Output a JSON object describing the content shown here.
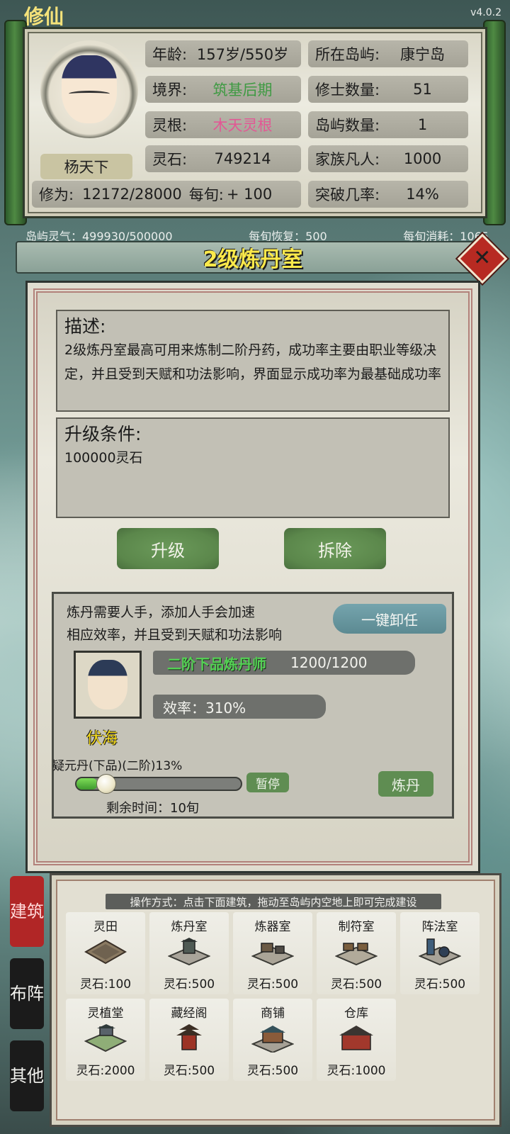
{
  "app": {
    "version": "v4.0.2",
    "corner_title": "修仙"
  },
  "player": {
    "name": "杨天下",
    "age_label": "年龄:",
    "age_value": "157岁/550岁",
    "realm_label": "境界:",
    "realm_value": "筑基后期",
    "root_label": "灵根:",
    "root_value": "木天灵根",
    "stone_label": "灵石:",
    "stone_value": "749214",
    "cultivation_label": "修为:",
    "cultivation_value": "12172/28000",
    "per_turn_label": "每旬:",
    "per_turn_value": "+ 100",
    "island_label": "所在岛屿:",
    "island_value": "康宁岛",
    "cultivators_label": "修士数量:",
    "cultivators_value": "51",
    "islands_label": "岛屿数量:",
    "islands_value": "1",
    "mortals_label": "家族凡人:",
    "mortals_value": "1000",
    "breakthrough_label": "突破几率:",
    "breakthrough_value": "14%"
  },
  "island_status": {
    "qi": "岛屿灵气：499930/500000",
    "recover": "每旬恢复：500",
    "consume": "每旬消耗：1065"
  },
  "dialog": {
    "title": "2级炼丹室",
    "close_icon": "close-icon",
    "desc_title": "描述:",
    "desc_text": "2级炼丹室最高可用来炼制二阶丹药，成功率主要由职业等级决定，并且受到天赋和功法影响，界面显示成功率为最基础成功率",
    "upgrade_title": "升级条件:",
    "upgrade_text": "100000灵石",
    "upgrade_button": "升级",
    "demolish_button": "拆除",
    "worker_note_1": "炼丹需要人手，添加人手会加速",
    "worker_note_2": "相应效率，并且受到天赋和功法影响",
    "dismiss_button": "一键卸任",
    "worker_name": "伏海",
    "worker_rank": "二阶下品炼丹师",
    "worker_exp": "1200/1200",
    "efficiency": "效率：310%",
    "brewing_item": "疑元丹(下品)(二阶)13%",
    "brewing_progress": 0.13,
    "pause_button": "暂停",
    "brew_button": "炼丹",
    "remaining_time": "剩余时间：10旬"
  },
  "side_tabs": [
    {
      "label": "建筑",
      "active": true
    },
    {
      "label": "布阵",
      "active": false
    },
    {
      "label": "其他",
      "active": false
    }
  ],
  "build_panel": {
    "hint": "操作方式：点击下面建筑，拖动至岛屿内空地上即可完成建设",
    "buildings": [
      {
        "name": "灵田",
        "cost": "灵石:100",
        "icon": "field-icon"
      },
      {
        "name": "炼丹室",
        "cost": "灵石:500",
        "icon": "alchemy-room-icon"
      },
      {
        "name": "炼器室",
        "cost": "灵石:500",
        "icon": "forge-room-icon"
      },
      {
        "name": "制符室",
        "cost": "灵石:500",
        "icon": "talisman-room-icon"
      },
      {
        "name": "阵法室",
        "cost": "灵石:500",
        "icon": "formation-room-icon"
      },
      {
        "name": "灵植堂",
        "cost": "灵石:2000",
        "icon": "herb-hall-icon"
      },
      {
        "name": "藏经阁",
        "cost": "灵石:500",
        "icon": "library-pavilion-icon"
      },
      {
        "name": "商铺",
        "cost": "灵石:500",
        "icon": "shop-icon"
      },
      {
        "name": "仓库",
        "cost": "灵石:1000",
        "icon": "warehouse-icon"
      }
    ]
  }
}
